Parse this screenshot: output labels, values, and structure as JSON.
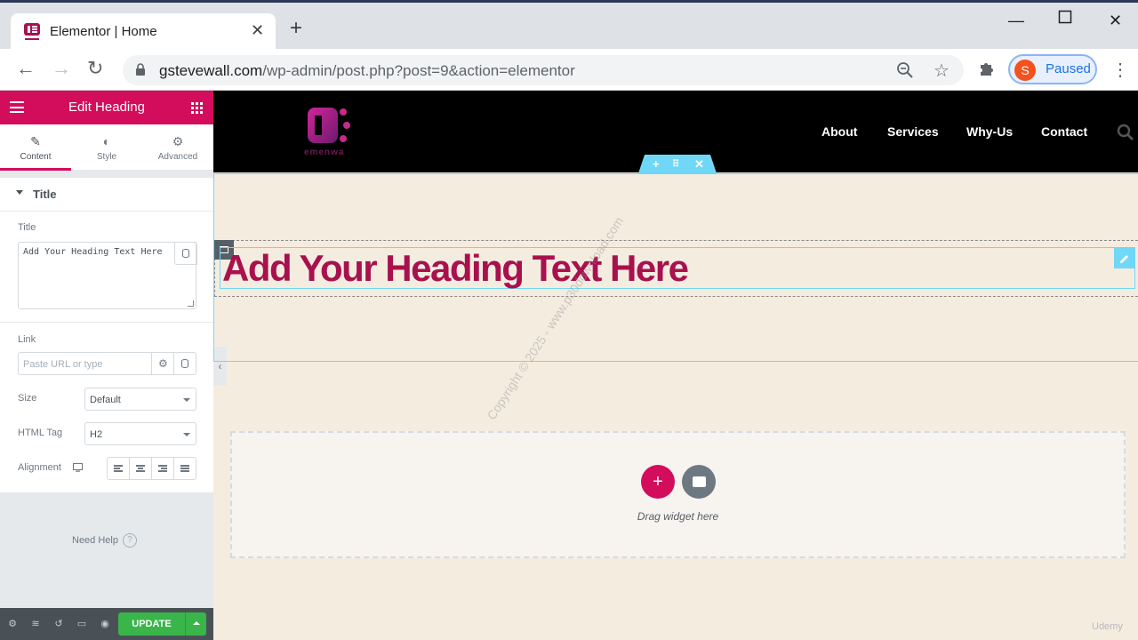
{
  "browser": {
    "tab_title": "Elementor | Home",
    "url_host": "gstevewall.com",
    "url_path": "/wp-admin/post.php?post=9&action=elementor",
    "profile_initial": "S",
    "profile_status": "Paused"
  },
  "panel": {
    "header_title": "Edit Heading",
    "tabs": [
      {
        "label": "Content",
        "icon": "pencil-icon"
      },
      {
        "label": "Style",
        "icon": "contrast-icon"
      },
      {
        "label": "Advanced",
        "icon": "gear-icon"
      }
    ],
    "section_title": "Title",
    "title_label": "Title",
    "title_value": "Add Your Heading Text Here",
    "link_label": "Link",
    "link_placeholder": "Paste URL or type",
    "size_label": "Size",
    "size_value": "Default",
    "tag_label": "HTML Tag",
    "tag_value": "H2",
    "alignment_label": "Alignment",
    "need_help": "Need Help",
    "update_label": "UPDATE"
  },
  "site": {
    "logo_text": "emenwa",
    "nav": [
      "About",
      "Services",
      "Why-Us",
      "Contact"
    ],
    "heading": "Add Your Heading Text Here",
    "drop_hint": "Drag widget here",
    "watermark": "Copyright © 2025 - www.p30download.com",
    "corner_brand": "Udemy"
  },
  "colors": {
    "elementor_pink": "#d30c5c",
    "heading_color": "#a8114e",
    "section_blue": "#71d7f7",
    "update_green": "#39b54a"
  }
}
